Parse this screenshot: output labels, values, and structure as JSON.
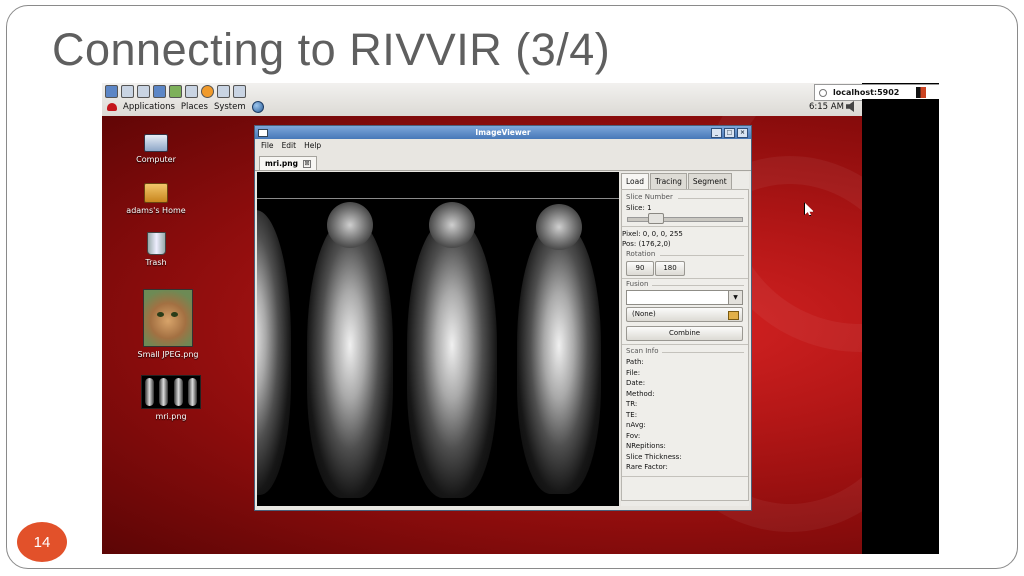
{
  "slide": {
    "title": "Connecting to RIVVIR (3/4)",
    "page_number": "14"
  },
  "vnc": {
    "host": "localhost:5902"
  },
  "panel": {
    "menus": [
      "Applications",
      "Places",
      "System"
    ],
    "clock": "6:15 AM"
  },
  "desktop": {
    "icons": [
      "Computer",
      "adams's Home",
      "Trash",
      "Small JPEG.png",
      "mri.png"
    ]
  },
  "window": {
    "title": "ImageViewer",
    "menus": [
      "File",
      "Edit",
      "Help"
    ],
    "doc_tab": "mri.png",
    "tabs": [
      "Load",
      "Tracing",
      "Segment"
    ],
    "slice_group": "Slice Number",
    "slice_value": "Slice: 1",
    "pixel": "Pixel: 0, 0, 0, 255",
    "pos": "Pos: (176,2,0)",
    "rotation_group": "Rotation",
    "rotation_buttons": [
      "90",
      "180"
    ],
    "fusion_group": "Fusion",
    "fusion_option": "(None)",
    "combine": "Combine",
    "scan_info_group": "Scan Info",
    "scan_fields": [
      "Path:",
      "File:",
      "Date:",
      "Method:",
      "TR:",
      "TE:",
      "nAvg:",
      "Fov:",
      "NRepitions:",
      "Slice Thickness:",
      "Rare Factor:"
    ]
  },
  "colors": {
    "badge": "#e2512a",
    "title": "#5f5f5f",
    "desktop_red": "#b51717"
  },
  "icons": [
    "computer-icon",
    "home-folder-icon",
    "trash-icon",
    "cat-image-icon",
    "mri-image-icon"
  ]
}
